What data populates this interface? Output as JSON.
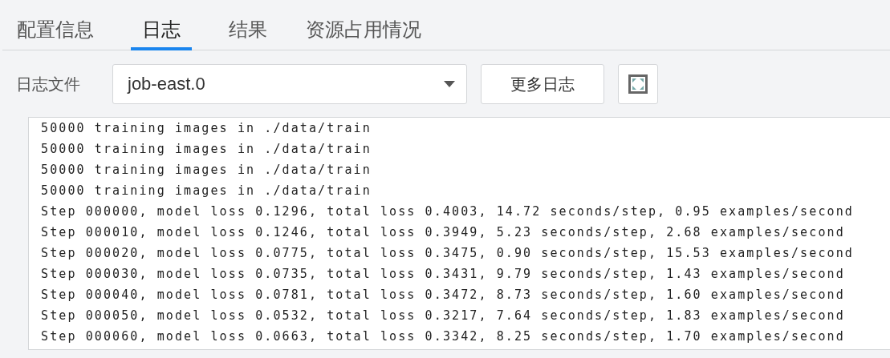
{
  "tabs": [
    {
      "label": "配置信息",
      "selected": false
    },
    {
      "label": "日志",
      "selected": true
    },
    {
      "label": "结果",
      "selected": false
    },
    {
      "label": "资源占用情况",
      "selected": false
    }
  ],
  "toolbar": {
    "file_label": "日志文件",
    "file_select": {
      "value": "job-east.0"
    },
    "more_button": "更多日志"
  },
  "log_lines": [
    "50000 training images in ./data/train",
    "50000 training images in ./data/train",
    "50000 training images in ./data/train",
    "50000 training images in ./data/train",
    "Step 000000, model loss 0.1296, total loss 0.4003, 14.72 seconds/step, 0.95 examples/second",
    "Step 000010, model loss 0.1246, total loss 0.3949, 5.23 seconds/step, 2.68 examples/second",
    "Step 000020, model loss 0.0775, total loss 0.3475, 0.90 seconds/step, 15.53 examples/second",
    "Step 000030, model loss 0.0735, total loss 0.3431, 9.79 seconds/step, 1.43 examples/second",
    "Step 000040, model loss 0.0781, total loss 0.3472, 8.73 seconds/step, 1.60 examples/second",
    "Step 000050, model loss 0.0532, total loss 0.3217, 7.64 seconds/step, 1.83 examples/second",
    "Step 000060, model loss 0.0663, total loss 0.3342, 8.25 seconds/step, 1.70 examples/second"
  ]
}
